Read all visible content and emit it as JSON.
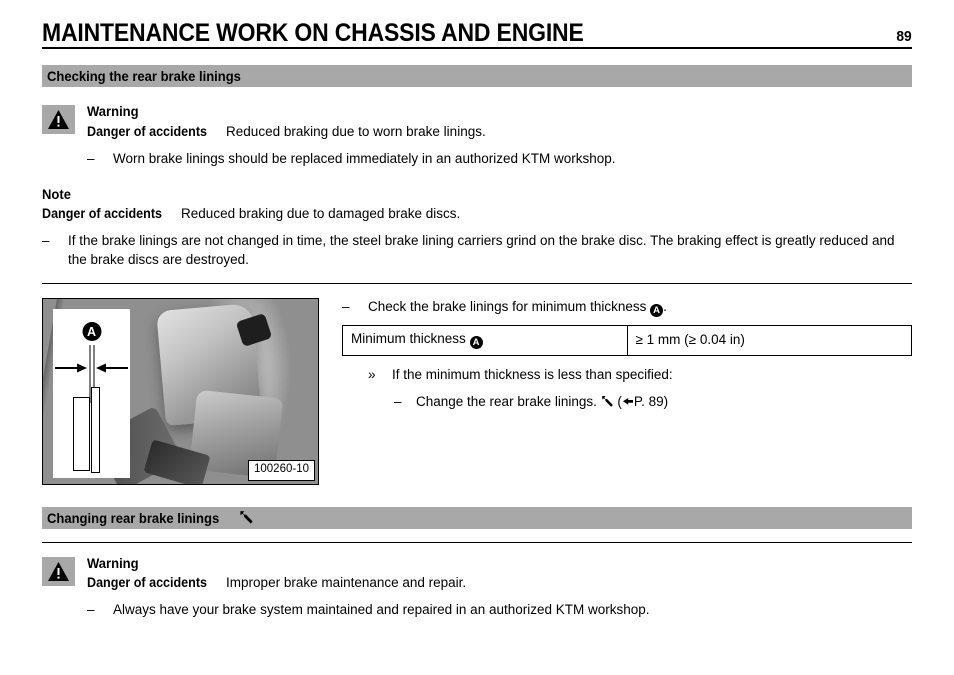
{
  "header": {
    "title": "MAINTENANCE WORK ON CHASSIS AND ENGINE",
    "page_number": "89"
  },
  "section1": {
    "heading": "Checking the rear brake linings",
    "warning": {
      "icon": "warning-triangle-icon",
      "title": "Warning",
      "label": "Danger of accidents",
      "description": "Reduced braking due to worn brake linings.",
      "bullets": [
        {
          "marker": "–",
          "text": "Worn brake linings should be replaced immediately in an authorized KTM workshop."
        }
      ]
    },
    "note": {
      "title": "Note",
      "label": "Danger of accidents",
      "description": "Reduced braking due to damaged brake discs.",
      "bullets": [
        {
          "marker": "–",
          "text": "If the brake linings are not changed in time, the steel brake lining carriers grind on the brake disc. The braking effect is greatly reduced and the brake discs are destroyed."
        }
      ]
    },
    "figure": {
      "caption": "100260-10",
      "callout": "A",
      "alt": "Rear brake caliper photo with inset lining thickness diagram"
    },
    "steps": {
      "main": {
        "marker": "–",
        "text_before": "Check the brake linings for minimum thickness ",
        "callout": "A",
        "text_after": "."
      },
      "table": {
        "label": "Minimum thickness ",
        "label_callout": "A",
        "value": "≥ 1 mm (≥ 0.04 in)"
      },
      "condition": {
        "marker": "»",
        "text": "If the minimum thickness is less than specified:"
      },
      "action": {
        "marker": "–",
        "text": "Change the rear brake linings.",
        "wrench_icon": "wrench-icon",
        "ref_open": "(",
        "ref_icon": "pointing-hand-icon",
        "ref_text": "P. 89)"
      }
    }
  },
  "section2": {
    "heading": "Changing rear brake linings",
    "heading_icon": "wrench-icon",
    "warning": {
      "icon": "warning-triangle-icon",
      "title": "Warning",
      "label": "Danger of accidents",
      "description": "Improper brake maintenance and repair.",
      "bullets": [
        {
          "marker": "–",
          "text": "Always have your brake system maintained and repaired in an authorized KTM workshop."
        }
      ]
    }
  },
  "colors": {
    "bar_gray": "#a8a8a8",
    "text": "#000000",
    "background": "#ffffff"
  }
}
